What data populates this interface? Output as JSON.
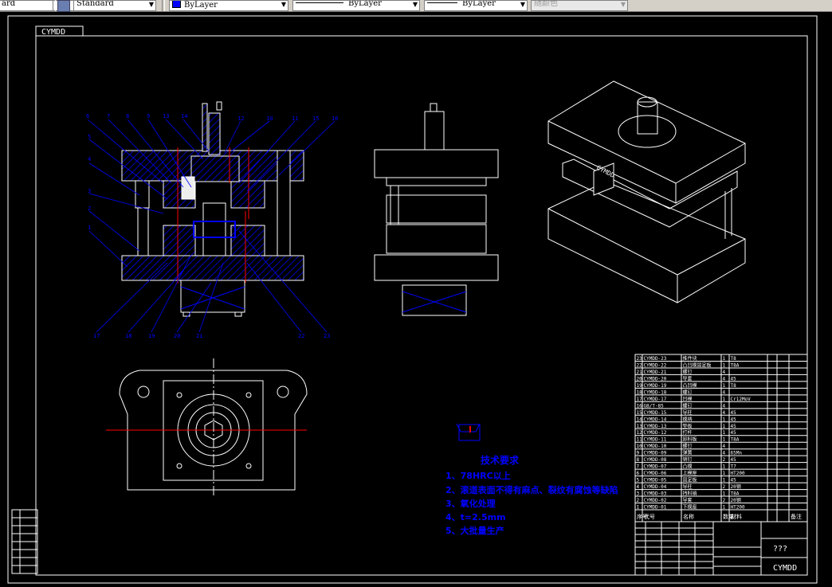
{
  "toolbar": {
    "text_style": "ard",
    "dim_style": "Standard",
    "layer_color": "ByLayer",
    "linetype": "ByLayer",
    "lineweight": "ByLayer",
    "plot_style": "随颜色",
    "layer_swatch_color": "#0000ff"
  },
  "drawing": {
    "corner_label": "CYMDD",
    "colors": {
      "background": "#000000",
      "outline": "#ffffff",
      "hatch": "#0000ff",
      "centerline": "#ff0000"
    },
    "iso_label": "CYMDD",
    "balloons_top": [
      "6",
      "7",
      "8",
      "9",
      "13",
      "14",
      "12",
      "10",
      "11",
      "15",
      "16"
    ],
    "balloons_left": [
      "5",
      "4",
      "3",
      "2",
      "1"
    ],
    "balloons_bottom": [
      "17",
      "18",
      "19",
      "20",
      "21",
      "22",
      "23"
    ]
  },
  "tech_requirements": {
    "title": "技术要求",
    "items": [
      "1、78HRC以上",
      "2、滚道表面不得有麻点、裂纹有腐蚀等缺陷",
      "3、氧化处理",
      "4、t=2.5mm",
      "5、大批量生产"
    ]
  },
  "parts_list": {
    "headers": [
      "序号",
      "代号",
      "名称",
      "数量",
      "材料",
      "",
      "",
      "备注"
    ],
    "rows": [
      [
        "23",
        "CYMDD-23",
        "推件块",
        "1",
        "T8"
      ],
      [
        "22",
        "CYMDD-22",
        "凸凹模固定板",
        "1",
        "T8A"
      ],
      [
        "21",
        "CYMDD-21",
        "螺钉",
        "4",
        ""
      ],
      [
        "20",
        "CYMDD-20",
        "导套",
        "4",
        "45"
      ],
      [
        "19",
        "CYMDD-19",
        "凸凹模",
        "1",
        "T8"
      ],
      [
        "18",
        "CYMDD-18",
        "螺钉",
        "4",
        ""
      ],
      [
        "17",
        "CYMDD-17",
        "凹模",
        "1",
        "Cr12MoV"
      ],
      [
        "16",
        "GB/T-85",
        "螺钉",
        "4",
        ""
      ],
      [
        "15",
        "CYMDD-15",
        "导柱",
        "4",
        "45"
      ],
      [
        "14",
        "CYMDD-14",
        "模柄",
        "1",
        "45"
      ],
      [
        "13",
        "CYMDD-13",
        "垫板",
        "1",
        "45"
      ],
      [
        "12",
        "CYMDD-12",
        "打杆",
        "1",
        "45"
      ],
      [
        "11",
        "CYMDD-11",
        "卸料板",
        "1",
        "T8A"
      ],
      [
        "10",
        "CYMDD-10",
        "螺钉",
        "4",
        ""
      ],
      [
        "9",
        "CYMDD-09",
        "弹簧",
        "4",
        "65Mn"
      ],
      [
        "8",
        "CYMDD-08",
        "销钉",
        "2",
        "45"
      ],
      [
        "7",
        "CYMDD-07",
        "凸模",
        "1",
        "T7"
      ],
      [
        "6",
        "CYMDD-06",
        "上模座",
        "1",
        "HT200"
      ],
      [
        "5",
        "CYMDD-05",
        "固定板",
        "1",
        "45"
      ],
      [
        "4",
        "CYMDD-04",
        "导柱",
        "2",
        "20钢"
      ],
      [
        "3",
        "CYMDD-03",
        "挡料销",
        "1",
        "T8A"
      ],
      [
        "2",
        "CYMDD-02",
        "导套",
        "2",
        "20钢"
      ],
      [
        "1",
        "CYMDD-01",
        "下模座",
        "1",
        "HT200"
      ]
    ]
  },
  "title_block": {
    "drawing_name": "???",
    "drawing_code": "CYMDD"
  }
}
